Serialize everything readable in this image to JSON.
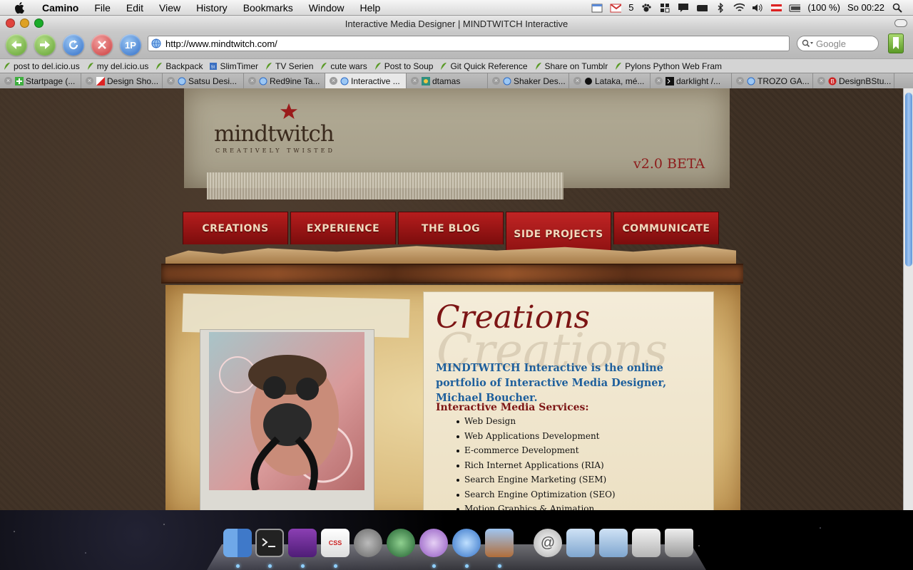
{
  "menubar": {
    "app_name": "Camino",
    "items": [
      "File",
      "Edit",
      "View",
      "History",
      "Bookmarks",
      "Window",
      "Help"
    ],
    "mail_count": "5",
    "battery": "(100 %)",
    "clock": "So 00:22"
  },
  "window": {
    "title": "Interactive Media Designer | MINDTWITCH Interactive",
    "url": "http://www.mindtwitch.com/",
    "search_placeholder": "Google",
    "onepassword_label": "1P"
  },
  "bookmarks": [
    "post to del.icio.us",
    "my del.icio.us",
    "Backpack",
    "SlimTimer",
    "TV Serien",
    "cute wars",
    "Post to Soup",
    "Git Quick Reference",
    "Share on Tumblr",
    "Pylons Python Web Fram"
  ],
  "tabs": [
    "Startpage (...",
    "Design Sho...",
    "Satsu Desi...",
    "Red9ine Ta...",
    "Interactive ...",
    "dtamas",
    "Shaker Des...",
    "Lataka, mé...",
    "darklight /...",
    "TROZO GA...",
    "DesignBStu..."
  ],
  "page": {
    "logo": "mindtwitch",
    "logo_tagline": "CREATIVELY TWISTED",
    "version": "v2.0 BETA",
    "nav": [
      "CREATIONS",
      "EXPERIENCE",
      "THE BLOG",
      "SIDE PROJECTS",
      "COMMUNICATE"
    ],
    "heading": "Creations",
    "intro": "MINDTWITCH Interactive is the online portfolio of Interactive Media Designer, Michael Boucher.",
    "services_heading": "Interactive Media Services:",
    "services": [
      "Web Design",
      "Web Applications Development",
      "E-commerce Development",
      "Rich Internet Applications (RIA)",
      "Search Engine Marketing (SEM)",
      "Search Engine Optimization (SEO)",
      "Motion Graphics & Animation"
    ]
  },
  "dock": {
    "css_icon_label": "CSS"
  },
  "colors": {
    "nav_red": "#a01818",
    "title_red": "#7c1414",
    "intro_blue": "#1e5f9c"
  }
}
